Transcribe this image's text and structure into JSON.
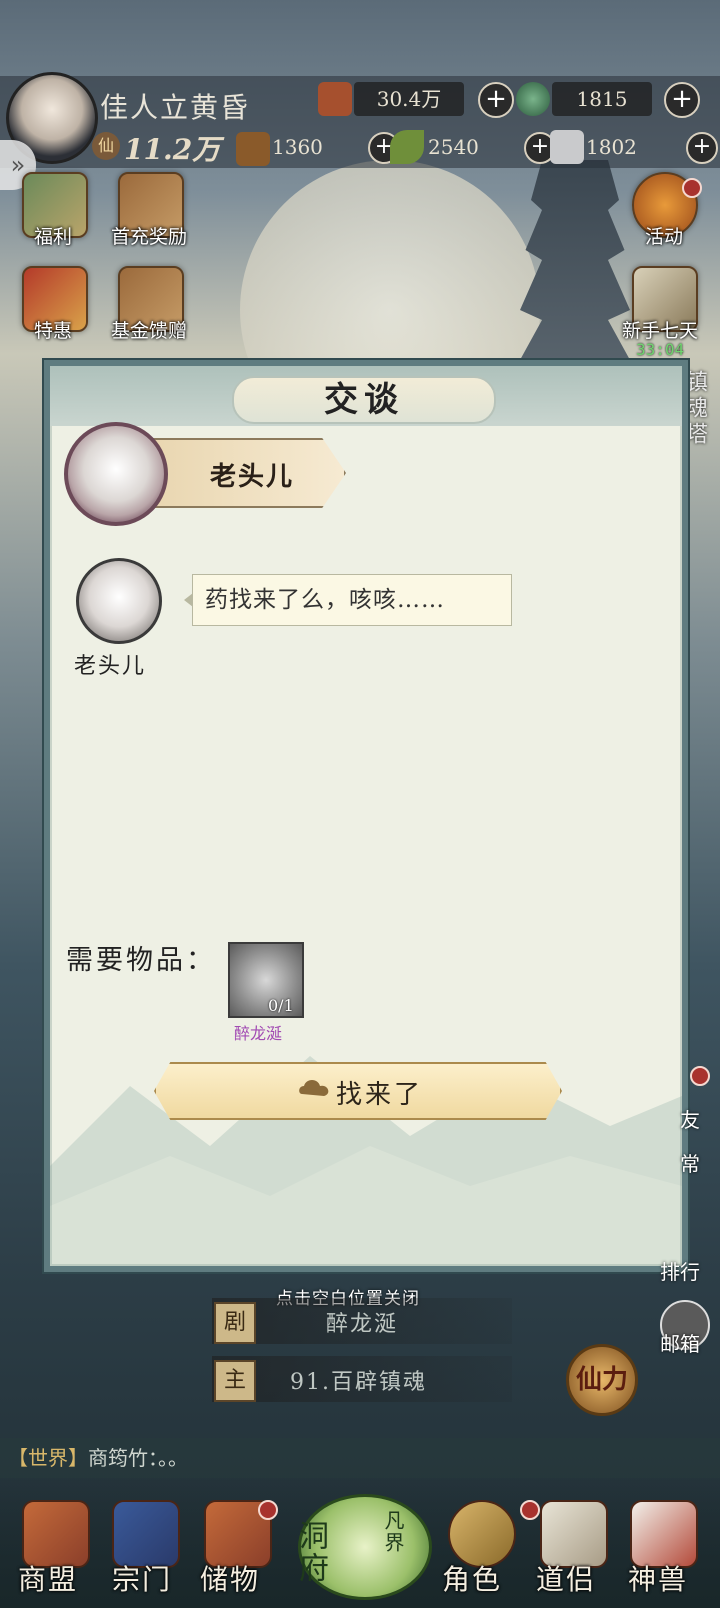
{
  "player": {
    "name": "佳人立黄昏",
    "power_icon": "仙",
    "power": "11.2万"
  },
  "resources": {
    "copper": "30.4万",
    "jade": "1815",
    "wood": "1360",
    "herb": "2540",
    "iron": "1802"
  },
  "side_left": [
    {
      "label": "福利"
    },
    {
      "label": "首充奖励"
    },
    {
      "label": "特惠"
    },
    {
      "label": "基金馈赠"
    }
  ],
  "side_right": [
    {
      "label": "活动"
    },
    {
      "label": "新手七天"
    }
  ],
  "timer": "33:04",
  "tower_label": "镇魂塔",
  "dialog": {
    "title": "交谈",
    "npc_name": "老头儿",
    "chat_speaker": "老头儿",
    "chat_text": "药找来了么，咳咳……",
    "need_label": "需要物品：",
    "item": {
      "name": "醉龙涎",
      "count": "0/1"
    },
    "confirm_button": "找来了"
  },
  "close_hint": "点击空白位置关闭",
  "quests": [
    {
      "tag": "剧",
      "text": "醉龙涎"
    },
    {
      "tag": "主",
      "text": "91.百辟镇魂"
    }
  ],
  "xianli_button": "仙力",
  "world_chat": {
    "channel": "【世界】",
    "text": "商筠竹：。。"
  },
  "right_side_labels": {
    "friends": "友",
    "daily": "常",
    "rank": "排行",
    "mail": "邮箱"
  },
  "bottom_nav": [
    {
      "label": "商盟",
      "icon": "merchant-icon"
    },
    {
      "label": "宗门",
      "icon": "sect-icon"
    },
    {
      "label": "储物",
      "icon": "storage-icon"
    },
    {
      "label": "洞府",
      "icon": "cave-icon"
    },
    {
      "label": "凡界",
      "icon": "mortal-realm-icon"
    },
    {
      "label": "角色",
      "icon": "character-icon"
    },
    {
      "label": "道侣",
      "icon": "partner-icon"
    },
    {
      "label": "神兽",
      "icon": "beast-icon"
    }
  ],
  "colors": {
    "dialog_border": "#5f7c80",
    "dialog_bg": "#eef0e4",
    "item_name": "#a24bb3",
    "button_gold": "#f0d9a0"
  }
}
